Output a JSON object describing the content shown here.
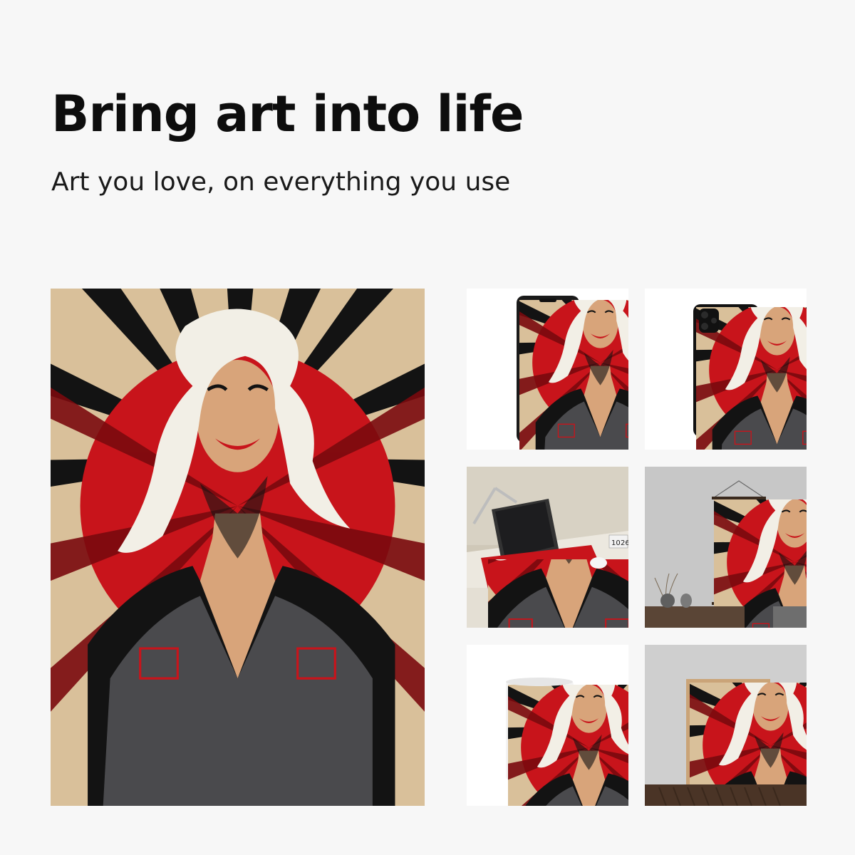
{
  "header": {
    "title": "Bring art into life",
    "subtitle": "Art you love, on everything you use"
  },
  "colors": {
    "background": "#f7f7f7",
    "art_red": "#c8141b",
    "art_beige": "#d9c09a",
    "art_black": "#131313",
    "shirt_gray": "#4a4a4d"
  },
  "gallery": {
    "hero": "framed-art-print",
    "products": [
      "phone-front-mockup",
      "phone-case-back-mockup",
      "desk-mousepad-mockup",
      "hanging-poster-mockup",
      "coffee-mug-mockup",
      "framed-print-mockup"
    ]
  },
  "mousepad_scene": {
    "calendar_left": "10",
    "calendar_right": "26"
  }
}
